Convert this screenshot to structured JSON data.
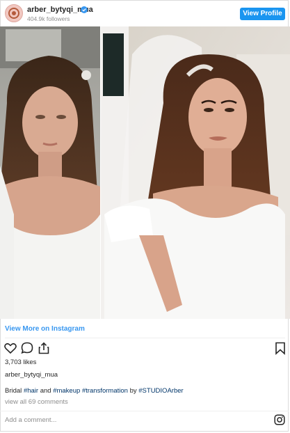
{
  "header": {
    "username": "arber_bytyqi_mua",
    "followers": "404.9k followers",
    "view_profile_label": "View Profile",
    "verified_icon": "verified-badge-icon"
  },
  "post": {
    "image_description_alt": "",
    "view_more_label": "View More on Instagram",
    "likes": "3,703 likes",
    "owner": "arber_bytyqi_mua",
    "caption_parts": {
      "p1": "Bridal ",
      "t1": "#hair",
      "p2": " and ",
      "t2": "#makeup",
      "p3": " ",
      "t3": "#transformation",
      "p4": " by ",
      "t4": "#STUDIOArber"
    },
    "comments_link": "view all 69 comments",
    "add_comment_placeholder": "Add a comment...",
    "icons": [
      "heart-icon",
      "comment-icon",
      "share-icon",
      "bookmark-icon",
      "instagram-icon"
    ]
  },
  "colors": {
    "accent": "#1a95f0",
    "link": "#3897f0",
    "hashtag": "#003569",
    "muted": "#8e8e8e"
  }
}
